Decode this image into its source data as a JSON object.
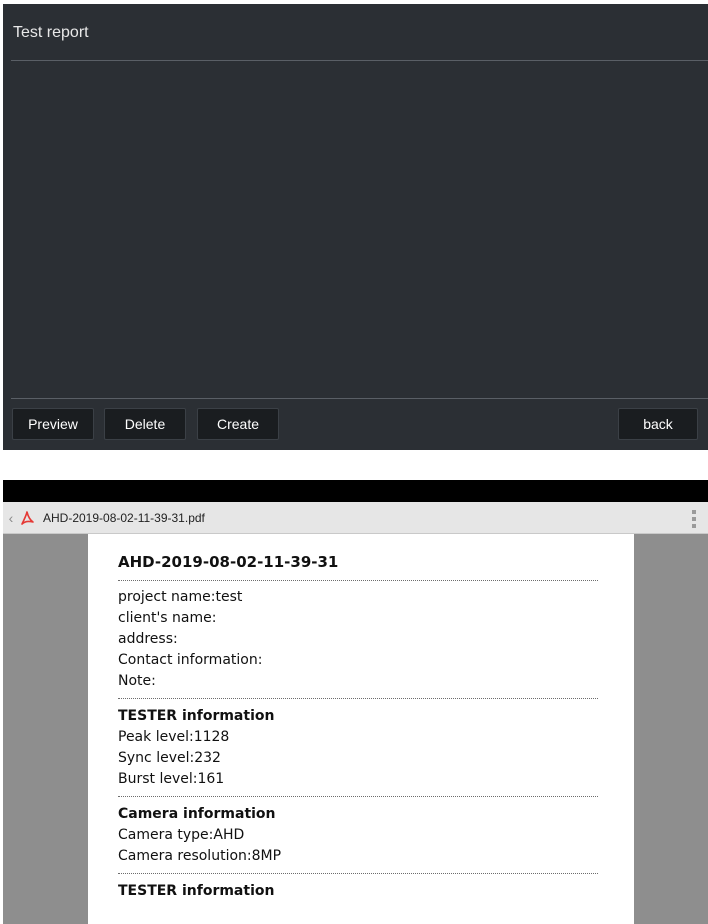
{
  "app": {
    "title": "Test report",
    "buttons": {
      "preview": "Preview",
      "delete": "Delete",
      "create": "Create",
      "back": "back"
    }
  },
  "viewer": {
    "filename": "AHD-2019-08-02-11-39-31.pdf",
    "icons": {
      "back": "chevron-left-icon",
      "file": "pdf-icon",
      "menu": "overflow-menu-icon"
    },
    "colors": {
      "pdf_icon": "#e53935"
    },
    "document": {
      "title": "AHD-2019-08-02-11-39-31",
      "project": [
        "project name:test",
        "client's name:",
        "address:",
        "Contact information:",
        "Note:"
      ],
      "tester": {
        "heading": "TESTER information",
        "lines": [
          "Peak level:1128",
          "Sync level:232",
          "Burst level:161"
        ]
      },
      "camera": {
        "heading": "Camera information",
        "lines": [
          "Camera type:AHD",
          "Camera resolution:8MP"
        ]
      },
      "tester2": {
        "heading": "TESTER information"
      }
    }
  }
}
